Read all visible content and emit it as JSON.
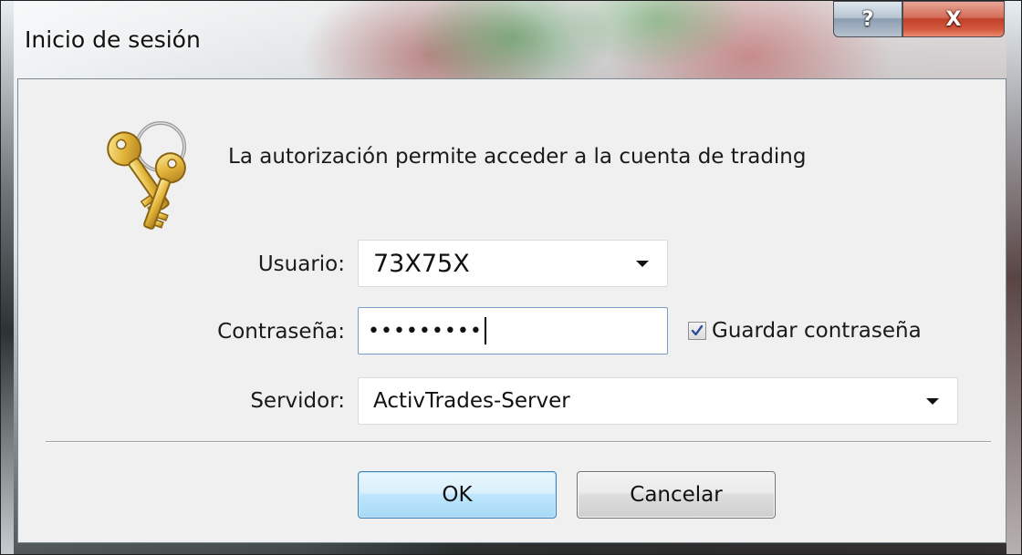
{
  "window": {
    "title": "Inicio de sesión",
    "help_label": "?",
    "close_label": "X"
  },
  "header": {
    "message": "La autorización permite acceder a la cuenta de trading",
    "icon": "keys-icon"
  },
  "form": {
    "user_label": "Usuario:",
    "user_value": "73X75X",
    "password_label": "Contraseña:",
    "password_value": "•••••••••",
    "save_password_label": "Guardar contraseña",
    "save_password_checked": true,
    "server_label": "Servidor:",
    "server_value": "ActivTrades-Server"
  },
  "buttons": {
    "ok_label": "OK",
    "cancel_label": "Cancelar"
  },
  "colors": {
    "dialog_bg": "#f0f0f0",
    "ok_button_border": "#3c7fb1",
    "close_button": "#c0402a"
  }
}
